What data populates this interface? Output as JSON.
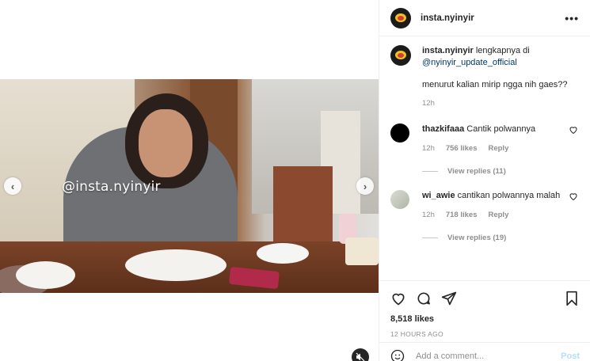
{
  "media": {
    "watermark": "@insta.nyinyir",
    "prev_icon": "chevron-left-icon",
    "next_icon": "chevron-right-icon",
    "mute_icon": "muted-speaker-icon"
  },
  "header": {
    "username": "insta.nyinyir",
    "more_icon": "more-horizontal-icon"
  },
  "caption": {
    "username": "insta.nyinyir",
    "text_before": " lengkapnya di",
    "mention": "@nyinyir_update_official",
    "line2": "menurut kalian mirip ngga nih gaes??",
    "time": "12h"
  },
  "comments": [
    {
      "username": "thazkifaaa",
      "text": " Cantik polwannya",
      "time": "12h",
      "likes": "756 likes",
      "reply_label": "Reply",
      "view_replies": "View replies (11)",
      "avatar_color": "#000000"
    },
    {
      "username": "wi_awie",
      "text": " cantikan polwannya malah",
      "time": "12h",
      "likes": "718 likes",
      "reply_label": "Reply",
      "view_replies": "View replies (19)",
      "avatar_color": "#c9d0c4"
    }
  ],
  "actions": {
    "like_icon": "heart-icon",
    "comment_icon": "comment-icon",
    "share_icon": "paper-plane-icon",
    "save_icon": "bookmark-icon",
    "likes": "8,518 likes",
    "date": "12 HOURS AGO"
  },
  "add_comment": {
    "placeholder": "Add a comment...",
    "post_label": "Post",
    "emoji_icon": "smiley-icon"
  }
}
